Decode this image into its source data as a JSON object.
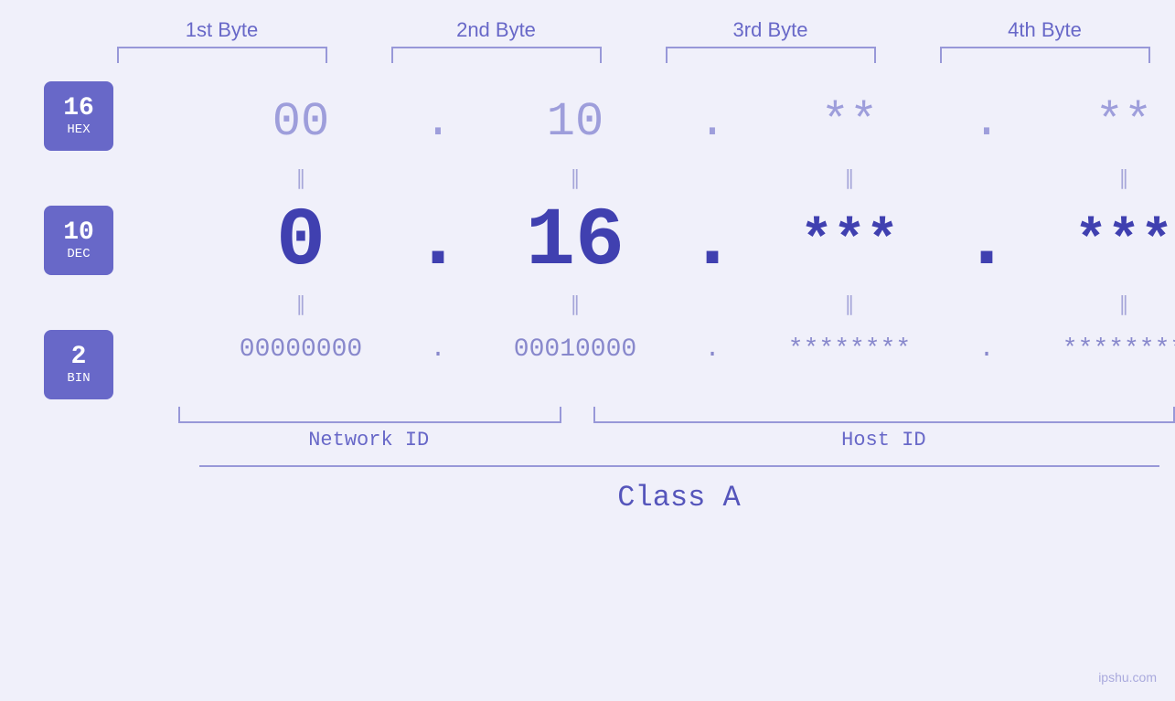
{
  "header": {
    "byte1": "1st Byte",
    "byte2": "2nd Byte",
    "byte3": "3rd Byte",
    "byte4": "4th Byte"
  },
  "badges": {
    "hex": {
      "number": "16",
      "label": "HEX"
    },
    "dec": {
      "number": "10",
      "label": "DEC"
    },
    "bin": {
      "number": "2",
      "label": "BIN"
    }
  },
  "hex_row": {
    "b1": "00",
    "b2": "10",
    "b3": "**",
    "b4": "**",
    "dot": "."
  },
  "dec_row": {
    "b1": "0",
    "b2": "16",
    "b3": "***",
    "b4": "***",
    "dot": "."
  },
  "bin_row": {
    "b1": "00000000",
    "b2": "00010000",
    "b3": "********",
    "b4": "********",
    "dot": "."
  },
  "labels": {
    "network_id": "Network ID",
    "host_id": "Host ID",
    "class": "Class A"
  },
  "watermark": "ipshu.com"
}
